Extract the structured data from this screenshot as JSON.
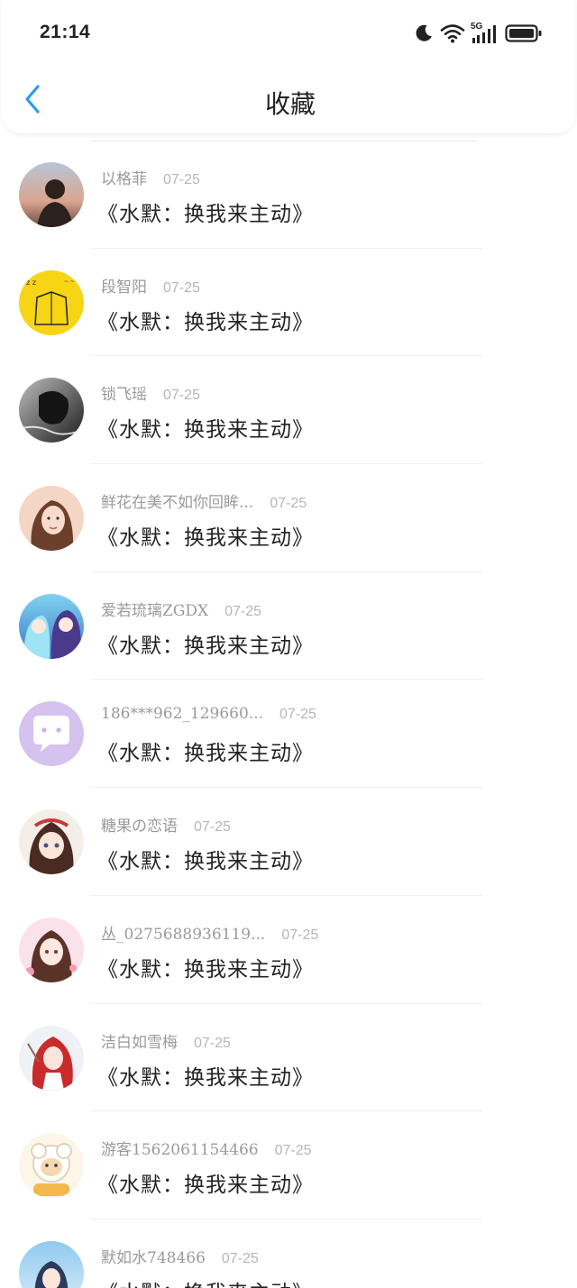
{
  "status_bar": {
    "time": "21:14",
    "network_label": "5G",
    "icons": [
      "moon-icon",
      "wifi-icon",
      "signal-icon",
      "battery-icon"
    ]
  },
  "nav": {
    "title": "收藏",
    "back_icon": "chevron-left-icon",
    "accent_color": "#2a9df4"
  },
  "favorites": [
    {
      "username": "以格菲",
      "date": "07-25",
      "title": "《水默：换我来主动》",
      "avatar_style": "photo-sunset"
    },
    {
      "username": "段智阳",
      "date": "07-25",
      "title": "《水默：换我来主动》",
      "avatar_style": "yellow-sketch"
    },
    {
      "username": "锁飞瑶",
      "date": "07-25",
      "title": "《水默：换我来主动》",
      "avatar_style": "dark-photo"
    },
    {
      "username": "鲜花在美不如你回眸...",
      "date": "07-25",
      "title": "《水默：换我来主动》",
      "avatar_style": "girl-photo"
    },
    {
      "username": "爱若琉璃ZGDX",
      "date": "07-25",
      "title": "《水默：换我来主动》",
      "avatar_style": "anime-blue"
    },
    {
      "username": "186***962_129660...",
      "date": "07-25",
      "title": "《水默：换我来主动》",
      "avatar_style": "default-chat"
    },
    {
      "username": "糖果の恋语",
      "date": "07-25",
      "title": "《水默：换我来主动》",
      "avatar_style": "anime-doll"
    },
    {
      "username": "丛_0275688936119...",
      "date": "07-25",
      "title": "《水默：换我来主动》",
      "avatar_style": "anime-pink"
    },
    {
      "username": "洁白如雪梅",
      "date": "07-25",
      "title": "《水默：换我来主动》",
      "avatar_style": "anime-red"
    },
    {
      "username": "游客1562061154466",
      "date": "07-25",
      "title": "《水默：换我来主动》",
      "avatar_style": "cartoon-sheep"
    },
    {
      "username": "默如水748466",
      "date": "07-25",
      "title": "《水默：换我来主动》",
      "avatar_style": "anime-sky"
    }
  ]
}
